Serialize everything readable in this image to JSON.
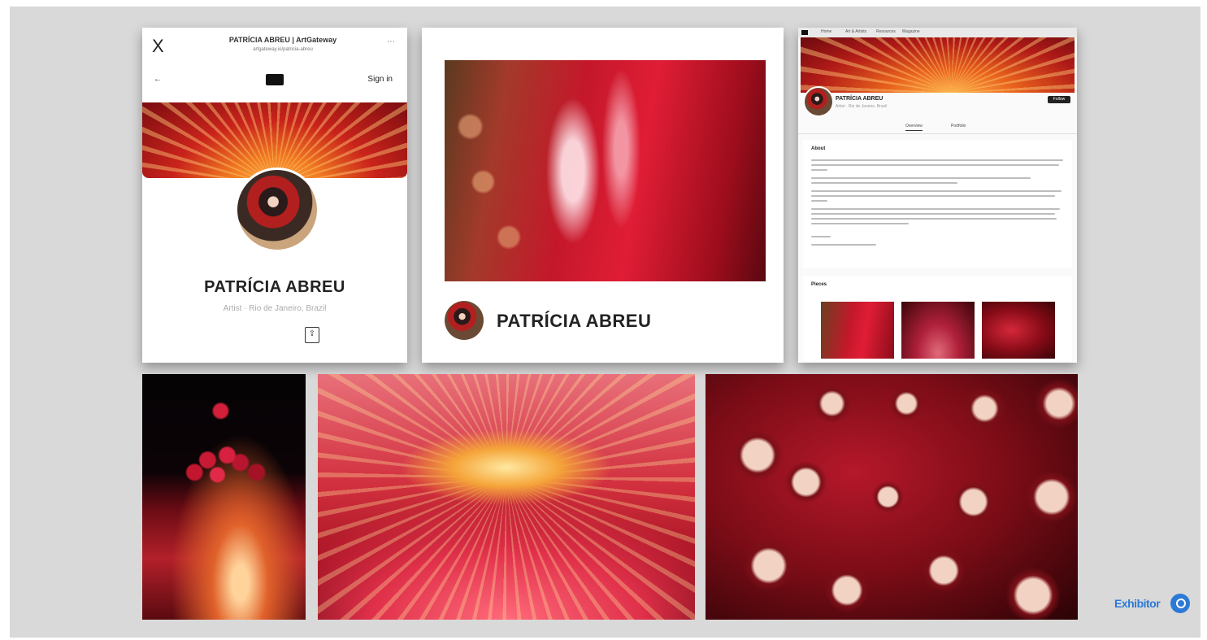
{
  "mobile": {
    "close_glyph": "X",
    "title": "PATRÍCIA ABREU | ArtGateway",
    "subtitle": "artgateway.io/patricia-abreu",
    "more": "⋯",
    "back": "←",
    "sign_in": "Sign in",
    "name": "PATRÍCIA ABREU",
    "location": "Artist · Rio de Janeiro, Brazil",
    "share": "⇪"
  },
  "middle": {
    "name": "PATRÍCIA ABREU"
  },
  "desktop": {
    "nav": [
      "Home",
      "Art & Artists",
      "Resources",
      "Magazine"
    ],
    "name": "PATRÍCIA ABREU",
    "subtitle": "Artist · Rio de Janeiro, Brazil",
    "follow": "Follow",
    "tabs": [
      "Overview",
      "Portfolio"
    ],
    "about_title": "About",
    "pieces_title": "Pieces"
  },
  "brand": {
    "label": "Exhibitor"
  }
}
